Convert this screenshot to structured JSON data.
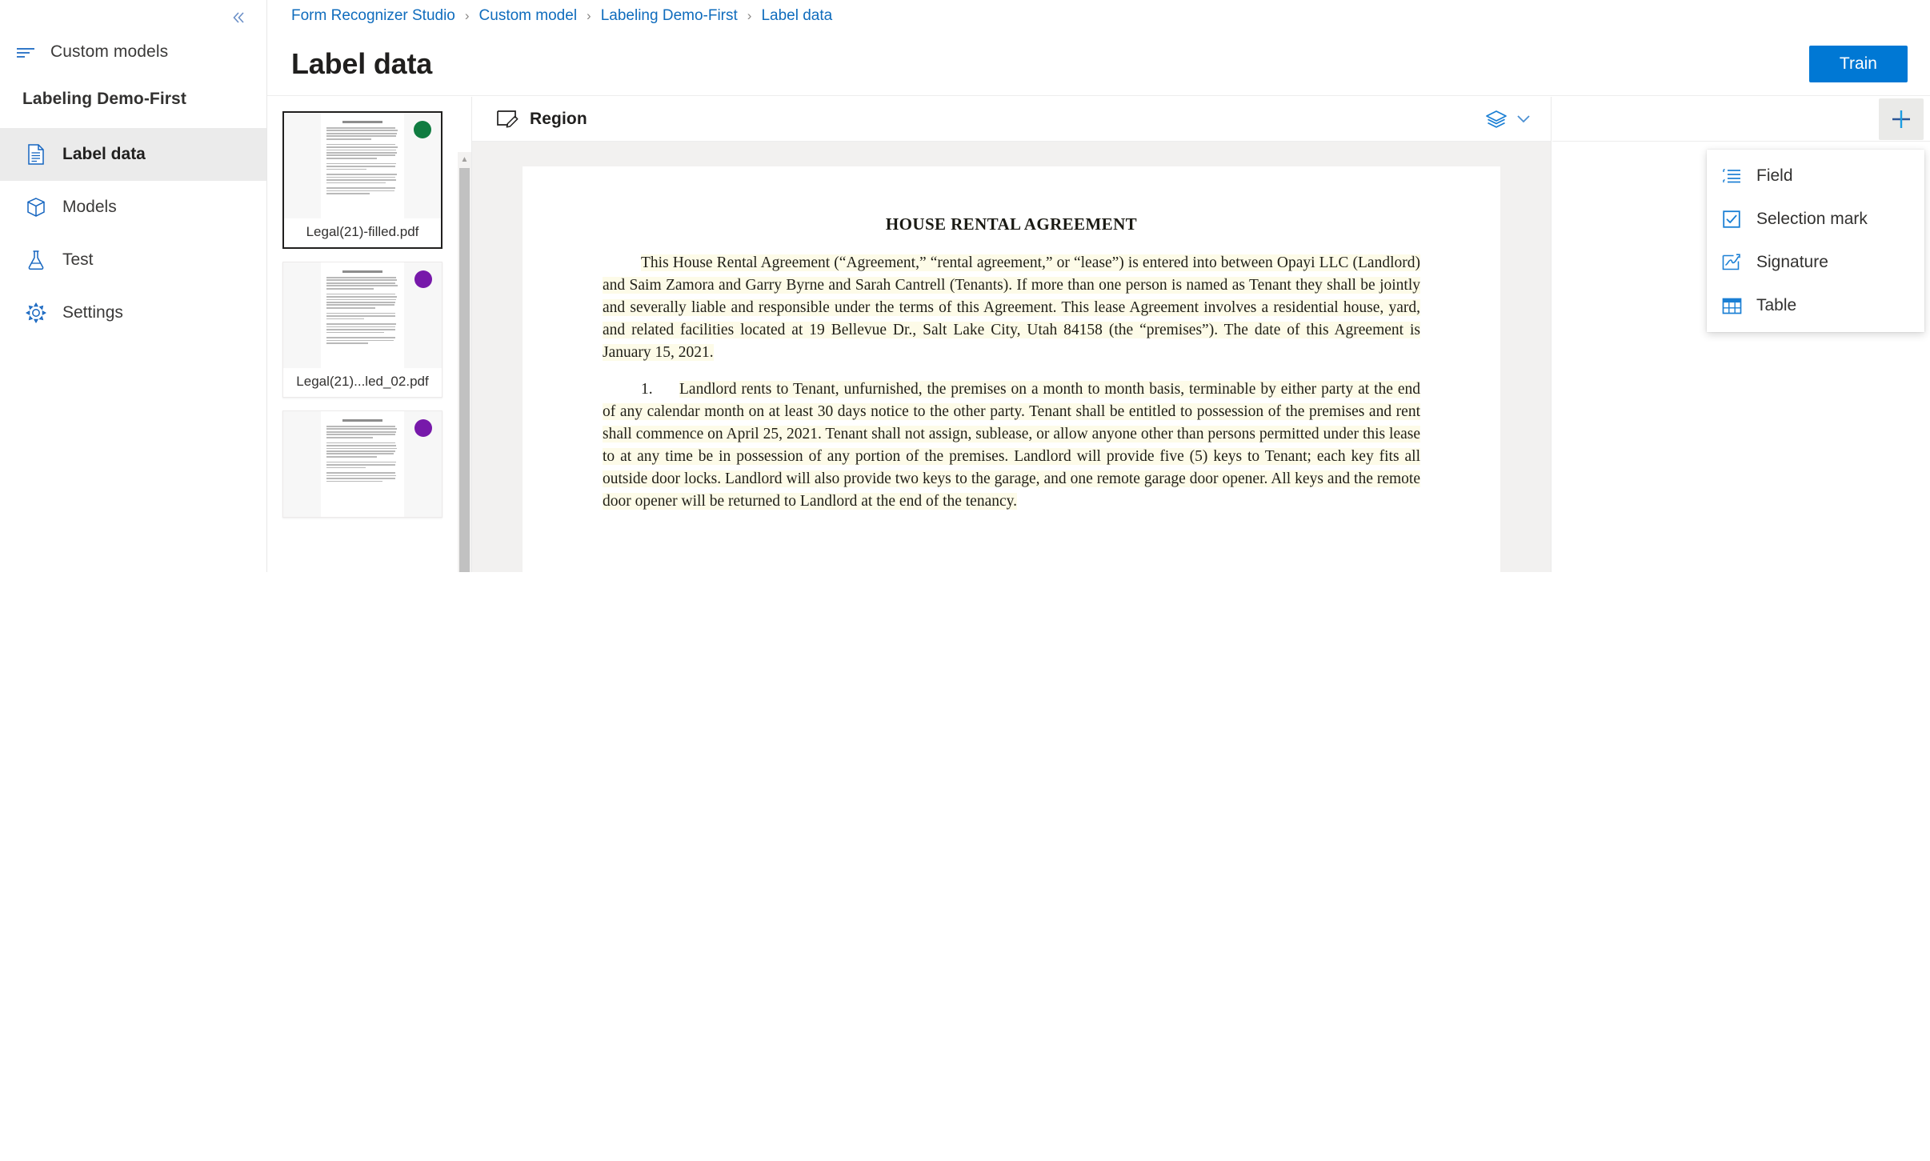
{
  "sidebar": {
    "collapse_icon": "chevron-double-left-icon",
    "menu_icon": "hamburger-menu-icon",
    "custom_models_label": "Custom models",
    "project_name": "Labeling Demo-First",
    "items": [
      {
        "label": "Label data",
        "icon": "document-icon",
        "selected": true
      },
      {
        "label": "Models",
        "icon": "package-box-icon",
        "selected": false
      },
      {
        "label": "Test",
        "icon": "flask-beaker-icon",
        "selected": false
      },
      {
        "label": "Settings",
        "icon": "gear-icon",
        "selected": false
      }
    ]
  },
  "breadcrumb": {
    "separator": "›",
    "items": [
      "Form Recognizer Studio",
      "Custom model",
      "Labeling Demo-First",
      "Label data"
    ]
  },
  "header": {
    "title": "Label data",
    "train_label": "Train"
  },
  "thumbnails": {
    "scroll_up_icon": "caret-up-icon",
    "items": [
      {
        "name": "Legal(21)-filled.pdf",
        "status_color": "#107c41",
        "active": true
      },
      {
        "name": "Legal(21)...led_02.pdf",
        "status_color": "#7719aa",
        "active": false
      },
      {
        "name": "",
        "status_color": "#7719aa",
        "active": false
      }
    ]
  },
  "viewer": {
    "toolbar": {
      "region_label": "Region",
      "region_icon": "region-draw-icon",
      "layers_icon": "layers-icon",
      "chevron_icon": "chevron-down-icon"
    },
    "document": {
      "title": "HOUSE RENTAL AGREEMENT",
      "paragraphs": [
        "This House Rental Agreement (“Agreement,” “rental agreement,” or “lease”) is entered into between Opayi LLC (Landlord) and Saim Zamora and Garry Byrne and Sarah Cantrell (Tenants).   If more than one person is named as Tenant they shall be jointly and severally liable and responsible under the terms of this Agreement.  This lease Agreement involves a residential house, yard, and related facilities located at 19 Bellevue Dr., Salt Lake City, Utah 84158 (the “premises”). The date of this Agreement is January 15, 2021."
      ],
      "clause_number": "1.",
      "clause_text": "Landlord rents to Tenant, unfurnished, the premises on a month to month basis, terminable by either party at the end of any calendar month on at least 30 days notice to the other party.  Tenant shall be entitled to possession of the premises and rent shall commence on April 25, 2021.  Tenant shall not assign, sublease, or allow anyone other than persons permitted under this lease to at any time be in possession of any portion of the premises.  Landlord will provide five (5) keys to Tenant; each key fits all outside door locks.  Landlord will also provide two keys to the garage, and one remote garage door opener.  All keys and the remote door opener will be returned to Landlord at the end of the tenancy."
    }
  },
  "label_panel": {
    "add_icon": "plus-icon",
    "add_menu": [
      {
        "label": "Field",
        "icon": "field-list-icon"
      },
      {
        "label": "Selection mark",
        "icon": "checkbox-checked-icon"
      },
      {
        "label": "Signature",
        "icon": "signature-icon"
      },
      {
        "label": "Table",
        "icon": "table-grid-icon"
      }
    ]
  },
  "colors": {
    "accent": "#0078d4",
    "link": "#0f6cbd",
    "selected_nav_bg": "#ebebeb",
    "canvas_bg": "#f2f1f0",
    "status_green": "#107c41",
    "status_purple": "#7719aa"
  }
}
